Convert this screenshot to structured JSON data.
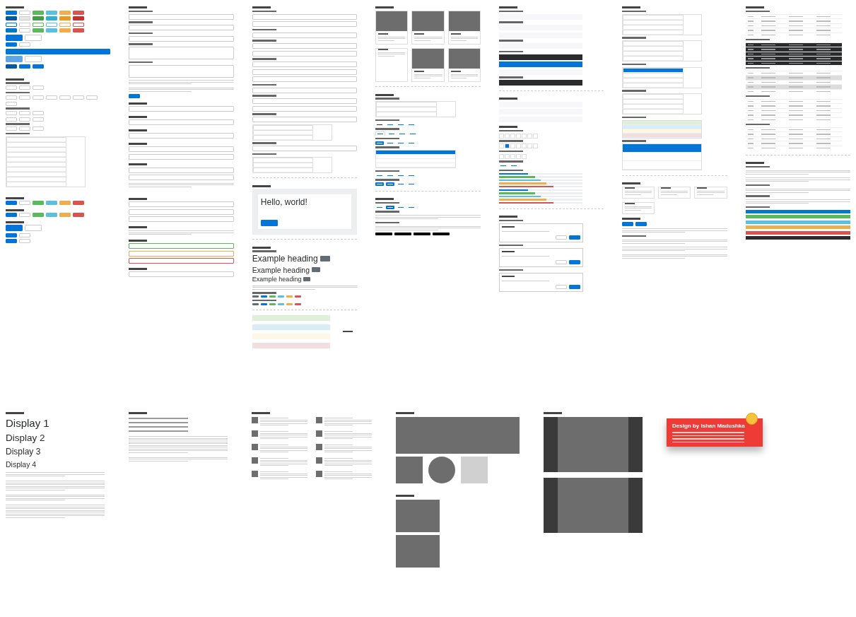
{
  "columns": [
    {
      "blocks": [
        {
          "kind": "title"
        },
        {
          "kind": "buttons",
          "items": [
            {
              "color": "#0275d8",
              "outline": false
            },
            {
              "color": "#ffffff",
              "outline": false
            },
            {
              "color": "#5cb85c",
              "outline": false
            },
            {
              "color": "#5bc0de",
              "outline": false
            },
            {
              "color": "#f0ad4e",
              "outline": false
            },
            {
              "color": "#d9534f",
              "outline": false
            }
          ]
        },
        {
          "kind": "buttons",
          "items": [
            {
              "color": "#025aa5",
              "outline": false
            },
            {
              "color": "#e6e6e6",
              "outline": false
            },
            {
              "color": "#449d44",
              "outline": false
            },
            {
              "color": "#31b0d5",
              "outline": false
            },
            {
              "color": "#ec971f",
              "outline": false
            },
            {
              "color": "#c9302c",
              "outline": false
            }
          ]
        },
        {
          "kind": "buttons",
          "items": [
            {
              "color": "#0275d8",
              "outline": true
            },
            {
              "color": "#cccccc",
              "outline": true
            },
            {
              "color": "#5cb85c",
              "outline": true
            },
            {
              "color": "#5bc0de",
              "outline": true
            },
            {
              "color": "#f0ad4e",
              "outline": true
            },
            {
              "color": "#d9534f",
              "outline": true
            }
          ]
        },
        {
          "kind": "buttons",
          "items": [
            {
              "color": "#0275d8",
              "outline": false
            },
            {
              "color": "#ffffff",
              "outline": false
            },
            {
              "color": "#5cb85c",
              "outline": false
            },
            {
              "color": "#5bc0de",
              "outline": false
            },
            {
              "color": "#f0ad4e",
              "outline": false
            },
            {
              "color": "#d9534f",
              "outline": false
            }
          ]
        },
        {
          "kind": "buttons-large",
          "items": [
            {
              "color": "#0275d8",
              "outline": false
            },
            {
              "color": "#ffffff",
              "outline": false
            }
          ]
        },
        {
          "kind": "buttons",
          "items": [
            {
              "color": "#0275d8",
              "outline": false
            },
            {
              "color": "#ffffff",
              "outline": false
            }
          ]
        },
        {
          "kind": "button-block",
          "color": "#0275d8"
        },
        {
          "kind": "buttons-large",
          "items": [
            {
              "color": "#5da7e8",
              "outline": false
            },
            {
              "color": "#ffffff",
              "outline": false
            }
          ]
        },
        {
          "kind": "buttons",
          "items": [
            {
              "color": "#025aa5",
              "outline": false
            },
            {
              "color": "#0275d8",
              "outline": false
            },
            {
              "color": "#0275d8",
              "outline": false
            }
          ]
        },
        {
          "kind": "gap"
        },
        {
          "kind": "title"
        },
        {
          "kind": "sub"
        },
        {
          "kind": "buttons",
          "items": [
            {
              "color": "#ffffff",
              "outline": false
            },
            {
              "color": "#ffffff",
              "outline": false
            },
            {
              "color": "#ffffff",
              "outline": false
            }
          ]
        },
        {
          "kind": "sub"
        },
        {
          "kind": "buttons",
          "items": [
            {
              "color": "#ffffff",
              "outline": false
            },
            {
              "color": "#ffffff",
              "outline": false
            },
            {
              "color": "#ffffff",
              "outline": false
            },
            {
              "color": "#ffffff",
              "outline": false
            },
            {
              "color": "#ffffff",
              "outline": false
            },
            {
              "color": "#ffffff",
              "outline": false
            },
            {
              "color": "#ffffff",
              "outline": false
            },
            {
              "color": "#ffffff",
              "outline": false
            }
          ]
        },
        {
          "kind": "sub"
        },
        {
          "kind": "buttons",
          "items": [
            {
              "color": "#ffffff",
              "outline": false
            },
            {
              "color": "#ffffff",
              "outline": false
            },
            {
              "color": "#ffffff",
              "outline": false
            }
          ]
        },
        {
          "kind": "buttons",
          "items": [
            {
              "color": "#ffffff",
              "outline": false
            },
            {
              "color": "#ffffff",
              "outline": false
            },
            {
              "color": "#ffffff",
              "outline": false
            }
          ]
        },
        {
          "kind": "sub"
        },
        {
          "kind": "buttons",
          "items": [
            {
              "color": "#ffffff",
              "outline": false
            },
            {
              "color": "#ffffff",
              "outline": false
            },
            {
              "color": "#ffffff",
              "outline": false
            }
          ]
        },
        {
          "kind": "sub"
        },
        {
          "kind": "list",
          "items": [
            {
              "selected": false
            },
            {
              "selected": false
            },
            {
              "selected": false
            },
            {
              "selected": false
            },
            {
              "selected": false
            },
            {
              "selected": false
            },
            {
              "selected": false
            },
            {
              "selected": false
            },
            {
              "selected": false
            },
            {
              "selected": false
            }
          ]
        },
        {
          "kind": "gap"
        },
        {
          "kind": "title"
        },
        {
          "kind": "buttons",
          "items": [
            {
              "color": "#0275d8",
              "outline": false
            },
            {
              "color": "#ffffff",
              "outline": false
            },
            {
              "color": "#5cb85c",
              "outline": false
            },
            {
              "color": "#5bc0de",
              "outline": false
            },
            {
              "color": "#f0ad4e",
              "outline": false
            },
            {
              "color": "#d9534f",
              "outline": false
            }
          ]
        },
        {
          "kind": "title"
        },
        {
          "kind": "buttons",
          "items": [
            {
              "color": "#0275d8",
              "outline": false
            },
            {
              "color": "#ffffff",
              "outline": false
            },
            {
              "color": "#5cb85c",
              "outline": false
            },
            {
              "color": "#5bc0de",
              "outline": false
            },
            {
              "color": "#f0ad4e",
              "outline": false
            },
            {
              "color": "#d9534f",
              "outline": false
            }
          ]
        },
        {
          "kind": "title"
        },
        {
          "kind": "buttons-large",
          "items": [
            {
              "color": "#0275d8",
              "outline": false
            },
            {
              "color": "#ffffff",
              "outline": false
            }
          ]
        },
        {
          "kind": "buttons",
          "items": [
            {
              "color": "#0275d8",
              "outline": false
            },
            {
              "color": "#ffffff",
              "outline": false
            }
          ]
        },
        {
          "kind": "buttons",
          "items": [
            {
              "color": "#0275d8",
              "outline": false
            },
            {
              "color": "#ffffff",
              "outline": false
            }
          ]
        }
      ]
    },
    {
      "blocks": [
        {
          "kind": "title"
        },
        {
          "kind": "sub"
        },
        {
          "kind": "field"
        },
        {
          "kind": "sub"
        },
        {
          "kind": "field"
        },
        {
          "kind": "sub"
        },
        {
          "kind": "field"
        },
        {
          "kind": "sub"
        },
        {
          "kind": "textarea"
        },
        {
          "kind": "sub"
        },
        {
          "kind": "textarea"
        },
        {
          "kind": "lines"
        },
        {
          "kind": "lines"
        },
        {
          "kind": "buttons",
          "items": [
            {
              "color": "#0275d8",
              "outline": false
            }
          ]
        },
        {
          "kind": "title"
        },
        {
          "kind": "field"
        },
        {
          "kind": "title"
        },
        {
          "kind": "field"
        },
        {
          "kind": "title"
        },
        {
          "kind": "field"
        },
        {
          "kind": "title"
        },
        {
          "kind": "field"
        },
        {
          "kind": "field"
        },
        {
          "kind": "title"
        },
        {
          "kind": "field"
        },
        {
          "kind": "field"
        },
        {
          "kind": "lines"
        },
        {
          "kind": "gap"
        },
        {
          "kind": "title"
        },
        {
          "kind": "field"
        },
        {
          "kind": "field"
        },
        {
          "kind": "field"
        },
        {
          "kind": "title"
        },
        {
          "kind": "lines"
        },
        {
          "kind": "title"
        },
        {
          "kind": "validation",
          "items": [
            {
              "color": "#5cb85c"
            },
            {
              "color": "#f0ad4e"
            },
            {
              "color": "#d9534f"
            }
          ]
        },
        {
          "kind": "title"
        },
        {
          "kind": "field"
        }
      ]
    },
    {
      "blocks": [
        {
          "kind": "title"
        },
        {
          "kind": "sub"
        },
        {
          "kind": "field"
        },
        {
          "kind": "field"
        },
        {
          "kind": "sub"
        },
        {
          "kind": "field"
        },
        {
          "kind": "sub"
        },
        {
          "kind": "field"
        },
        {
          "kind": "field"
        },
        {
          "kind": "sub"
        },
        {
          "kind": "field"
        },
        {
          "kind": "field"
        },
        {
          "kind": "field"
        },
        {
          "kind": "sub"
        },
        {
          "kind": "field"
        },
        {
          "kind": "sub"
        },
        {
          "kind": "field"
        },
        {
          "kind": "field"
        },
        {
          "kind": "sub"
        },
        {
          "kind": "field"
        },
        {
          "kind": "list",
          "items": [
            {
              "selected": false
            },
            {
              "selected": false
            },
            {
              "selected": false
            }
          ]
        },
        {
          "kind": "sub"
        },
        {
          "kind": "field"
        },
        {
          "kind": "sub"
        },
        {
          "kind": "list",
          "items": [
            {
              "selected": false
            },
            {
              "selected": false
            },
            {
              "selected": false
            }
          ]
        },
        {
          "kind": "divider"
        },
        {
          "kind": "title"
        },
        {
          "kind": "jumbotron",
          "title": "Hello, world!"
        },
        {
          "kind": "divider"
        },
        {
          "kind": "title"
        },
        {
          "kind": "sub"
        },
        {
          "kind": "headings",
          "items": [
            {
              "text": "Example heading"
            },
            {
              "text": "Example heading"
            },
            {
              "text": "Example heading"
            }
          ]
        },
        {
          "kind": "lines"
        },
        {
          "kind": "sub"
        },
        {
          "kind": "badges",
          "items": [
            {
              "color": "#636c72"
            },
            {
              "color": "#0275d8"
            },
            {
              "color": "#5cb85c"
            },
            {
              "color": "#5bc0de"
            },
            {
              "color": "#f0ad4e"
            },
            {
              "color": "#d9534f"
            }
          ]
        },
        {
          "kind": "sub"
        },
        {
          "kind": "badges",
          "items": [
            {
              "color": "#636c72"
            },
            {
              "color": "#0275d8"
            },
            {
              "color": "#5cb85c"
            },
            {
              "color": "#5bc0de"
            },
            {
              "color": "#f0ad4e"
            },
            {
              "color": "#d9534f"
            }
          ]
        },
        {
          "kind": "divider"
        },
        {
          "kind": "alerts",
          "items": [
            {
              "color": "#dff0d8"
            },
            {
              "color": "#d9edf7"
            },
            {
              "color": "#fcf8e3"
            },
            {
              "color": "#f2dede"
            }
          ]
        }
      ]
    },
    {
      "blocks": [
        {
          "kind": "title"
        },
        {
          "kind": "cards",
          "items": [
            {
              "image": true
            },
            {
              "image": true
            },
            {
              "image": true
            },
            {
              "image": false
            },
            {
              "image": true
            },
            {
              "image": true
            }
          ]
        },
        {
          "kind": "divider"
        },
        {
          "kind": "title"
        },
        {
          "kind": "sub"
        },
        {
          "kind": "list",
          "items": [
            {
              "selected": false
            },
            {
              "selected": false
            },
            {
              "selected": false
            }
          ]
        },
        {
          "kind": "sub"
        },
        {
          "kind": "nav-links",
          "items": [
            {
              "selected": true
            },
            {
              "selected": false
            },
            {
              "selected": false
            },
            {
              "selected": false
            }
          ]
        },
        {
          "kind": "sub"
        },
        {
          "kind": "nav-tabs",
          "items": [
            {
              "selected": true
            },
            {
              "selected": false
            },
            {
              "selected": false
            },
            {
              "selected": false
            }
          ]
        },
        {
          "kind": "sub"
        },
        {
          "kind": "nav-pills",
          "items": [
            {
              "selected": true
            },
            {
              "selected": false
            },
            {
              "selected": false
            },
            {
              "selected": false
            }
          ]
        },
        {
          "kind": "sub"
        },
        {
          "kind": "stacked",
          "items": [
            {
              "selected": true
            },
            {
              "selected": false
            },
            {
              "selected": false
            },
            {
              "selected": false
            }
          ]
        },
        {
          "kind": "sub"
        },
        {
          "kind": "nav-links",
          "items": [
            {
              "selected": false
            },
            {
              "selected": false
            },
            {
              "selected": false
            },
            {
              "selected": false
            }
          ]
        },
        {
          "kind": "sub"
        },
        {
          "kind": "nav-pills",
          "items": [
            {
              "selected": true
            },
            {
              "selected": true
            },
            {
              "selected": false
            },
            {
              "selected": false
            }
          ]
        },
        {
          "kind": "divider"
        },
        {
          "kind": "title"
        },
        {
          "kind": "sub"
        },
        {
          "kind": "nav-pills",
          "items": [
            {
              "selected": false
            },
            {
              "selected": true
            },
            {
              "selected": false
            },
            {
              "selected": false
            }
          ]
        },
        {
          "kind": "sub"
        },
        {
          "kind": "lines"
        },
        {
          "kind": "sub"
        },
        {
          "kind": "lines"
        },
        {
          "kind": "tooltips"
        }
      ]
    },
    {
      "blocks": [
        {
          "kind": "title"
        },
        {
          "kind": "sub"
        },
        {
          "kind": "navbar-light"
        },
        {
          "kind": "sub"
        },
        {
          "kind": "navbar-light"
        },
        {
          "kind": "navbar-light"
        },
        {
          "kind": "sub"
        },
        {
          "kind": "navbar-light"
        },
        {
          "kind": "sub"
        },
        {
          "kind": "navbar-dark"
        },
        {
          "kind": "navbar-primary"
        },
        {
          "kind": "navbar-light"
        },
        {
          "kind": "sub"
        },
        {
          "kind": "navbar-dark"
        },
        {
          "kind": "divider"
        },
        {
          "kind": "title"
        },
        {
          "kind": "navbar-light"
        },
        {
          "kind": "navbar-light"
        },
        {
          "kind": "navbar-light"
        },
        {
          "kind": "title"
        },
        {
          "kind": "sub"
        },
        {
          "kind": "pagination",
          "items": [
            {
              "selected": false
            },
            {
              "selected": false
            },
            {
              "selected": false
            },
            {
              "selected": false
            },
            {
              "selected": false
            },
            {
              "selected": false
            },
            {
              "selected": false
            }
          ]
        },
        {
          "kind": "sub"
        },
        {
          "kind": "pagination",
          "items": [
            {
              "selected": false
            },
            {
              "selected": true
            },
            {
              "selected": false
            },
            {
              "selected": false
            },
            {
              "selected": false
            },
            {
              "selected": false
            },
            {
              "selected": false
            }
          ]
        },
        {
          "kind": "sub"
        },
        {
          "kind": "pagination",
          "items": [
            {
              "selected": false
            },
            {
              "selected": false
            },
            {
              "selected": false
            },
            {
              "selected": false
            },
            {
              "selected": false
            }
          ]
        },
        {
          "kind": "sub"
        },
        {
          "kind": "nav-links",
          "items": [
            {
              "selected": false
            },
            {
              "selected": false
            }
          ]
        },
        {
          "kind": "sub"
        },
        {
          "kind": "progress",
          "items": [
            {
              "level": 0.35,
              "color": "#0275d8"
            },
            {
              "level": 0.43,
              "color": "#5cb85c"
            },
            {
              "level": 0.5,
              "color": "#5bc0de"
            },
            {
              "level": 0.57,
              "color": "#f0ad4e"
            },
            {
              "level": 0.65,
              "color": "#d9534f"
            }
          ]
        },
        {
          "kind": "progress",
          "items": [
            {
              "level": 0.35,
              "color": "#0275d8"
            },
            {
              "level": 0.43,
              "color": "#5cb85c"
            },
            {
              "level": 0.5,
              "color": "#5bc0de"
            },
            {
              "level": 0.57,
              "color": "#f0ad4e"
            },
            {
              "level": 0.65,
              "color": "#d9534f"
            }
          ]
        },
        {
          "kind": "divider"
        },
        {
          "kind": "title"
        },
        {
          "kind": "sub"
        },
        {
          "kind": "modal"
        },
        {
          "kind": "sub"
        },
        {
          "kind": "modal"
        },
        {
          "kind": "sub"
        },
        {
          "kind": "modal"
        }
      ]
    },
    {
      "blocks": [
        {
          "kind": "title"
        },
        {
          "kind": "sub"
        },
        {
          "kind": "list",
          "items": [
            {
              "selected": false
            },
            {
              "selected": false
            },
            {
              "selected": false
            },
            {
              "selected": false
            }
          ]
        },
        {
          "kind": "sub"
        },
        {
          "kind": "list",
          "items": [
            {
              "selected": false
            },
            {
              "selected": false
            },
            {
              "selected": false
            },
            {
              "selected": false
            }
          ]
        },
        {
          "kind": "sub"
        },
        {
          "kind": "list",
          "items": [
            {
              "selected": true
            },
            {
              "selected": false
            },
            {
              "selected": false
            },
            {
              "selected": false
            }
          ]
        },
        {
          "kind": "sub"
        },
        {
          "kind": "list",
          "items": [
            {
              "selected": false
            },
            {
              "selected": false
            },
            {
              "selected": false
            },
            {
              "selected": false
            }
          ]
        },
        {
          "kind": "sub"
        },
        {
          "kind": "contextual",
          "items": [
            {
              "color": "#dff0d8"
            },
            {
              "color": "#d9edf7"
            },
            {
              "color": "#fcf8e3"
            },
            {
              "color": "#f2dede"
            }
          ]
        },
        {
          "kind": "sub"
        },
        {
          "kind": "custom-list",
          "items": [
            {
              "selected": true
            },
            {
              "selected": false
            },
            {
              "selected": false
            }
          ]
        },
        {
          "kind": "divider"
        },
        {
          "kind": "title"
        },
        {
          "kind": "cards",
          "items": [
            {
              "image": false
            },
            {
              "image": false
            },
            {
              "image": false
            },
            {
              "image": false
            }
          ]
        },
        {
          "kind": "title"
        },
        {
          "kind": "buttons",
          "items": [
            {
              "color": "#0275d8",
              "outline": false
            },
            {
              "color": "#0275d8",
              "outline": false
            }
          ]
        },
        {
          "kind": "lines"
        },
        {
          "kind": "sub"
        },
        {
          "kind": "lines"
        },
        {
          "kind": "lines"
        },
        {
          "kind": "lines"
        }
      ]
    },
    {
      "blocks": [
        {
          "kind": "title"
        },
        {
          "kind": "sub"
        },
        {
          "kind": "table",
          "dark": false,
          "striped": false
        },
        {
          "kind": "sub"
        },
        {
          "kind": "table",
          "dark": true,
          "striped": false
        },
        {
          "kind": "sub"
        },
        {
          "kind": "table",
          "dark": false,
          "striped": true
        },
        {
          "kind": "sub"
        },
        {
          "kind": "table",
          "dark": false,
          "striped": false
        },
        {
          "kind": "sub"
        },
        {
          "kind": "table",
          "dark": false,
          "striped": false
        },
        {
          "kind": "divider"
        },
        {
          "kind": "title"
        },
        {
          "kind": "sub"
        },
        {
          "kind": "lines"
        },
        {
          "kind": "lines"
        },
        {
          "kind": "sub"
        },
        {
          "kind": "lines"
        },
        {
          "kind": "sub"
        },
        {
          "kind": "lines"
        },
        {
          "kind": "sub"
        },
        {
          "kind": "swatches",
          "items": [
            {
              "color": "#0275d8"
            },
            {
              "color": "#5cb85c"
            },
            {
              "color": "#5bc0de"
            },
            {
              "color": "#f0ad4e"
            },
            {
              "color": "#d9534f"
            },
            {
              "color": "#292b2c"
            }
          ]
        }
      ]
    }
  ],
  "bottom": {
    "displays": [
      "Display 1",
      "Display 2",
      "Display 3",
      "Display 4"
    ],
    "credit_title": "Design by Ishan Madushka"
  }
}
